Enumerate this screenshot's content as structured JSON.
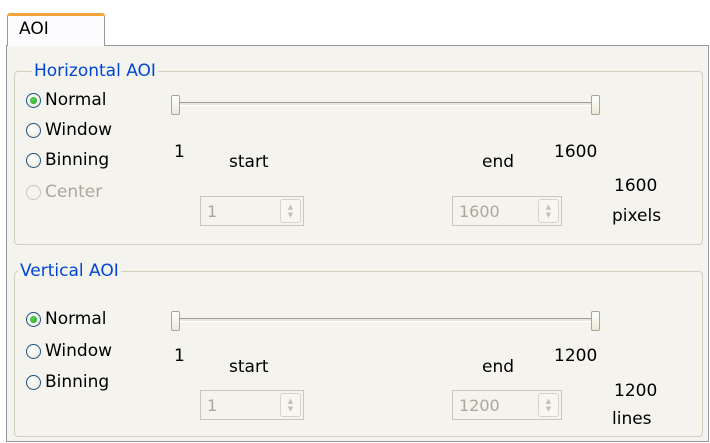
{
  "tab": {
    "label": "AOI"
  },
  "horizontal": {
    "title": "Horizontal AOI",
    "modes": [
      {
        "label": "Normal",
        "checked": true,
        "enabled": true
      },
      {
        "label": "Window",
        "checked": false,
        "enabled": true
      },
      {
        "label": "Binning",
        "checked": false,
        "enabled": true
      },
      {
        "label": "Center",
        "checked": false,
        "enabled": false
      }
    ],
    "slider": {
      "min": 1,
      "max": 1600,
      "low": 1,
      "high": 1600
    },
    "min_label": "1",
    "max_label": "1600",
    "start_label": "start",
    "end_label": "end",
    "start_value": "1",
    "end_value": "1600",
    "size_value": "1600",
    "size_unit": "pixels"
  },
  "vertical": {
    "title": "Vertical AOI",
    "modes": [
      {
        "label": "Normal",
        "checked": true,
        "enabled": true
      },
      {
        "label": "Window",
        "checked": false,
        "enabled": true
      },
      {
        "label": "Binning",
        "checked": false,
        "enabled": true
      }
    ],
    "slider": {
      "min": 1,
      "max": 1200,
      "low": 1,
      "high": 1200
    },
    "min_label": "1",
    "max_label": "1200",
    "start_label": "start",
    "end_label": "end",
    "start_value": "1",
    "end_value": "1200",
    "size_value": "1200",
    "size_unit": "lines"
  },
  "colors": {
    "group_title": "#0046d5",
    "panel_bg": "#f4f3ee",
    "tab_accent": "#f3a33b"
  }
}
